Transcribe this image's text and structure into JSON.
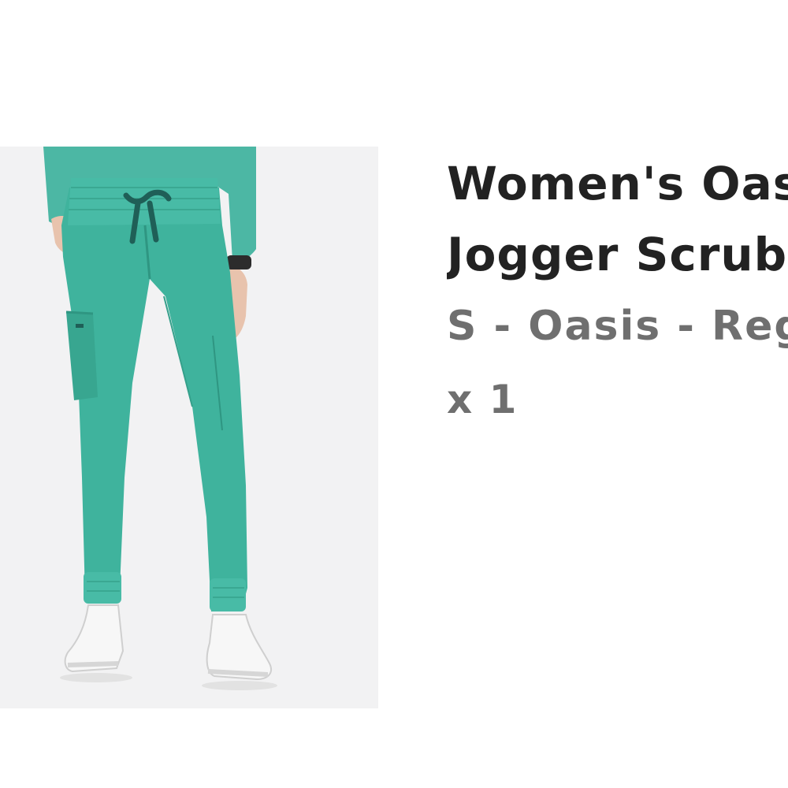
{
  "product": {
    "title_line1": "Women's Oasis",
    "title_line2": "Jogger Scrub Pants",
    "variant": "S - Oasis - Regular",
    "quantity": "x 1",
    "image_icon": "product-photo-icon"
  },
  "colors": {
    "scrub": "#3fb39d",
    "scrub_dark": "#2f9682",
    "drawstring": "#1f5f57",
    "image_background": "#f2f2f3",
    "title_text": "#222222",
    "secondary_text": "#6f6f6f"
  }
}
